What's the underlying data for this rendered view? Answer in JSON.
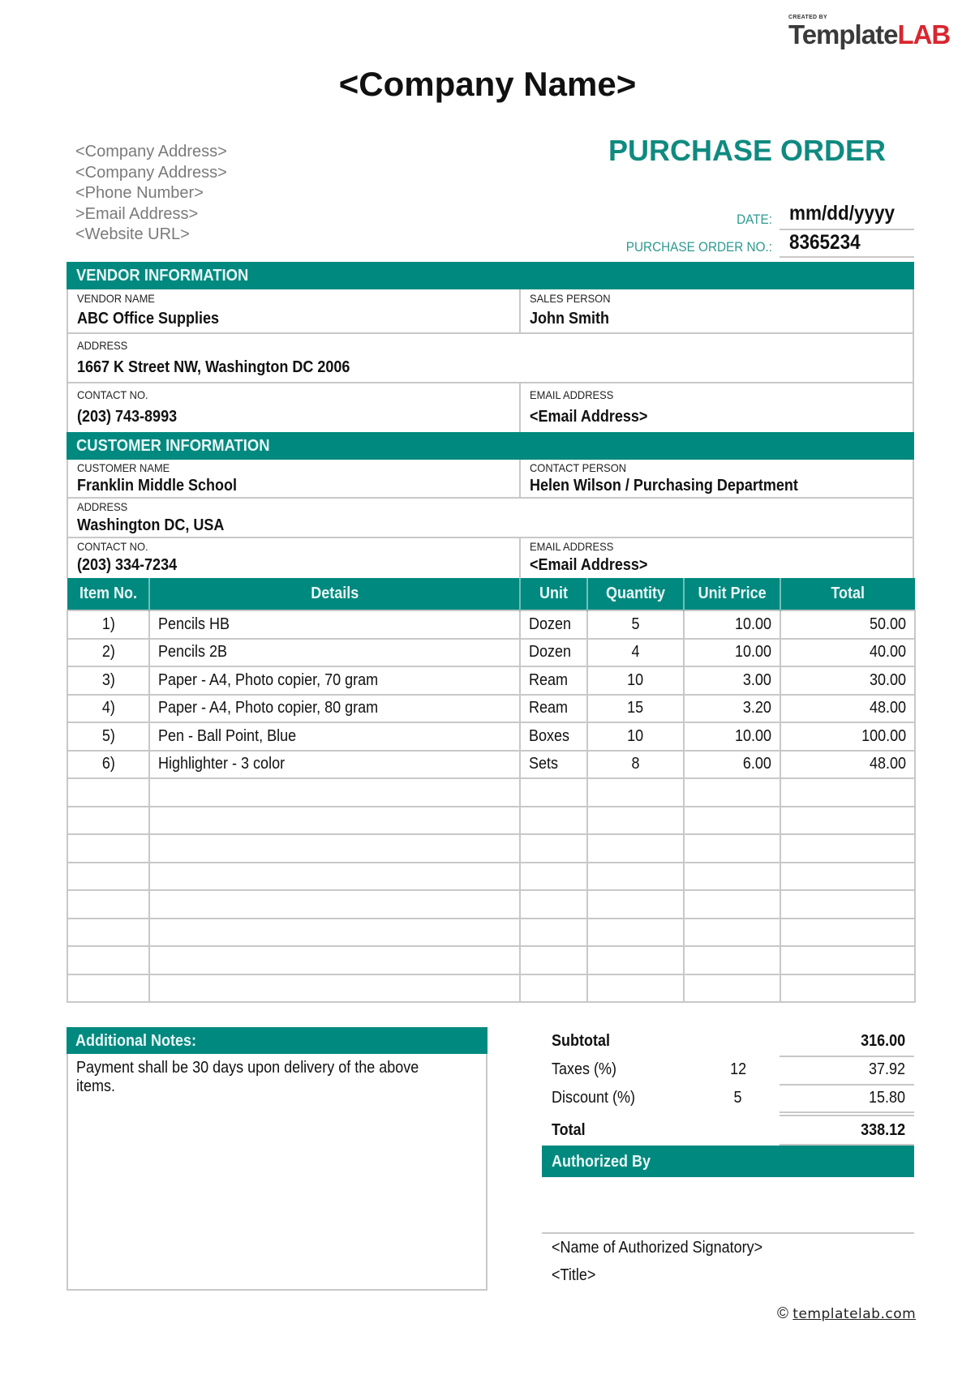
{
  "logo": {
    "created_by": "CREATED BY",
    "brand_part1": "Template",
    "brand_part2": "LAB"
  },
  "company": {
    "name": "<Company Name>",
    "address_lines": [
      "<Company Address>",
      "<Company Address>",
      "<Phone Number>",
      ">Email Address>",
      "<Website URL>"
    ]
  },
  "document": {
    "title": "PURCHASE ORDER",
    "date_label": "DATE:",
    "date_value": "mm/dd/yyyy",
    "po_no_label": "PURCHASE ORDER NO.:",
    "po_no_value": "8365234"
  },
  "vendor": {
    "section_title": "VENDOR INFORMATION",
    "name_label": "VENDOR NAME",
    "name": "ABC Office Supplies",
    "sales_person_label": "SALES PERSON",
    "sales_person": "John Smith",
    "address_label": "ADDRESS",
    "address": "1667 K Street NW, Washington DC   2006",
    "contact_label": "CONTACT NO.",
    "contact": "(203) 743-8993",
    "email_label": "EMAIL ADDRESS",
    "email": "<Email Address>"
  },
  "customer": {
    "section_title": "CUSTOMER INFORMATION",
    "name_label": "CUSTOMER NAME",
    "name": "Franklin Middle School",
    "contact_person_label": "CONTACT PERSON",
    "contact_person": "Helen Wilson / Purchasing Department",
    "address_label": "ADDRESS",
    "address": "Washington DC, USA",
    "contact_label": "CONTACT NO.",
    "contact": "(203) 334-7234",
    "email_label": "EMAIL ADDRESS",
    "email": "<Email Address>"
  },
  "items": {
    "columns": [
      "Item No.",
      "Details",
      "Unit",
      "Quantity",
      "Unit Price",
      "Total"
    ],
    "rows": [
      {
        "no": "1)",
        "details": "Pencils HB",
        "unit": "Dozen",
        "qty": "5",
        "price": "10.00",
        "total": "50.00"
      },
      {
        "no": "2)",
        "details": "Pencils 2B",
        "unit": "Dozen",
        "qty": "4",
        "price": "10.00",
        "total": "40.00"
      },
      {
        "no": "3)",
        "details": "Paper - A4, Photo copier, 70 gram",
        "unit": "Ream",
        "qty": "10",
        "price": "3.00",
        "total": "30.00"
      },
      {
        "no": "4)",
        "details": "Paper - A4, Photo copier, 80 gram",
        "unit": "Ream",
        "qty": "15",
        "price": "3.20",
        "total": "48.00"
      },
      {
        "no": "5)",
        "details": "Pen - Ball Point, Blue",
        "unit": "Boxes",
        "qty": "10",
        "price": "10.00",
        "total": "100.00"
      },
      {
        "no": "6)",
        "details": "Highlighter - 3 color",
        "unit": "Sets",
        "qty": "8",
        "price": "6.00",
        "total": "48.00"
      },
      {
        "no": "",
        "details": "",
        "unit": "",
        "qty": "",
        "price": "",
        "total": ""
      },
      {
        "no": "",
        "details": "",
        "unit": "",
        "qty": "",
        "price": "",
        "total": ""
      },
      {
        "no": "",
        "details": "",
        "unit": "",
        "qty": "",
        "price": "",
        "total": ""
      },
      {
        "no": "",
        "details": "",
        "unit": "",
        "qty": "",
        "price": "",
        "total": ""
      },
      {
        "no": "",
        "details": "",
        "unit": "",
        "qty": "",
        "price": "",
        "total": ""
      },
      {
        "no": "",
        "details": "",
        "unit": "",
        "qty": "",
        "price": "",
        "total": ""
      },
      {
        "no": "",
        "details": "",
        "unit": "",
        "qty": "",
        "price": "",
        "total": ""
      },
      {
        "no": "",
        "details": "",
        "unit": "",
        "qty": "",
        "price": "",
        "total": ""
      }
    ]
  },
  "notes": {
    "title": "Additional Notes:",
    "text": "Payment shall be 30 days upon delivery of the above items."
  },
  "totals": {
    "subtotal_label": "Subtotal",
    "subtotal": "316.00",
    "taxes_label": "Taxes (%)",
    "taxes_pct": "12",
    "taxes": "37.92",
    "discount_label": "Discount (%)",
    "discount_pct": "5",
    "discount": "15.80",
    "total_label": "Total",
    "total": "338.12"
  },
  "authorization": {
    "title": "Authorized By",
    "signatory": "<Name of Authorized Signatory>",
    "signatory_title": "<Title>"
  },
  "footer": {
    "copyright_symbol": "©",
    "link_text": "templatelab.com"
  },
  "colors": {
    "accent": "#00897f",
    "brand_red": "#d8262f",
    "border": "#c8c8c8"
  }
}
